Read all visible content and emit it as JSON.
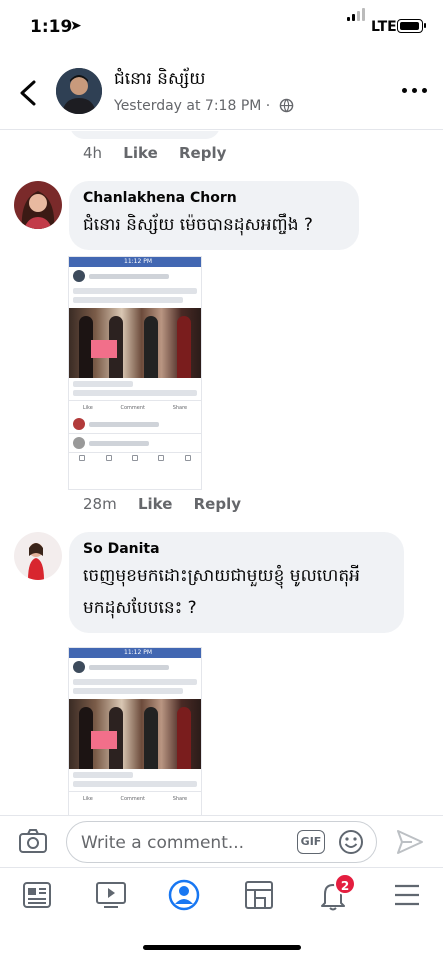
{
  "status_bar": {
    "time": "1:19",
    "network": "LTE"
  },
  "header": {
    "author": "ជំនោរ និស្ស័យ",
    "timestamp": "Yesterday at 7:18 PM ·"
  },
  "prev_comment": {
    "time": "4h",
    "like": "Like",
    "reply": "Reply"
  },
  "comments": [
    {
      "name": "Chanlakhena Chorn",
      "lines": [
        "ជំនោរ និស្ស័យ   ម៉េចបានដុសអញ្ចឹង ?"
      ],
      "time": "28m",
      "like": "Like",
      "reply": "Reply"
    },
    {
      "name": "So Danita",
      "lines": [
        "ចេញមុខមកដោះស្រាយជាមួយខ្ញុំ មូលហេតុអី",
        "មកដុសបែបនេះ ?"
      ]
    }
  ],
  "composer": {
    "placeholder": "Write a comment...",
    "gif": "GIF"
  },
  "tabbar": {
    "notification_count": "2"
  },
  "colors": {
    "accent": "#1877f2",
    "muted": "#65676b",
    "bubble": "#f0f2f5",
    "badge": "#e41e3f"
  }
}
